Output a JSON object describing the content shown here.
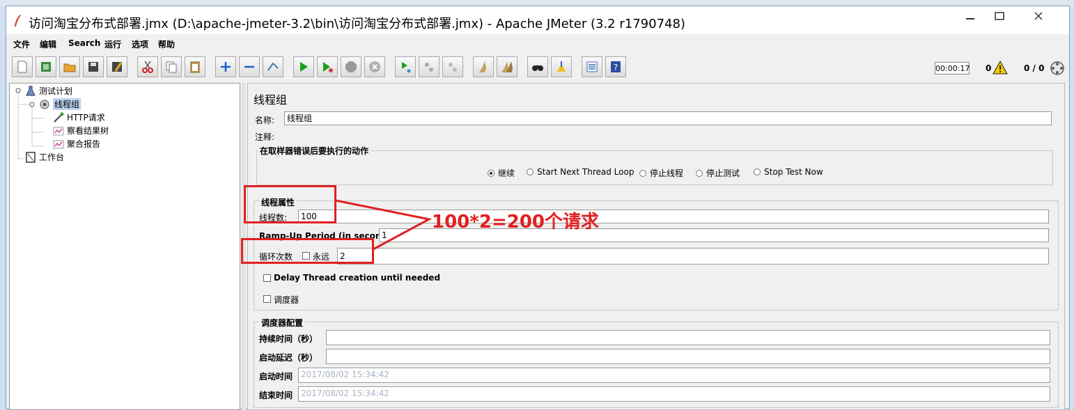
{
  "window": {
    "title": "访问淘宝分布式部署.jmx (D:\\apache-jmeter-3.2\\bin\\访问淘宝分布式部署.jmx) - Apache JMeter (3.2 r1790748)",
    "minimize_icon": "minimize-icon",
    "maximize_icon": "maximize-icon",
    "close_icon": "close-icon"
  },
  "menu": [
    "文件",
    "编辑",
    "Search",
    "运行",
    "选项",
    "帮助"
  ],
  "toolbar": {
    "icons": [
      "new-icon",
      "templates-icon",
      "open-icon",
      "save-icon",
      "save-as-icon",
      "cut-icon",
      "copy-icon",
      "paste-icon",
      "expand-icon",
      "collapse-icon",
      "toggle-icon",
      "start-icon",
      "start-no-pause-icon",
      "stop-icon",
      "shutdown-icon",
      "remote-start-icon",
      "remote-stop-icon",
      "remote-shutdown-icon",
      "clear-icon",
      "clear-all-icon",
      "search-icon",
      "reset-search-icon",
      "function-helper-icon",
      "help-icon"
    ],
    "timer": "00:00:17",
    "warning_count": "0",
    "thread_count": "0 / 0",
    "colors": {
      "start": "#1e9e1e",
      "stop": "#9a9a9a",
      "add": "#1a5fd0",
      "cut": "#d02020"
    }
  },
  "tree": {
    "items": [
      {
        "label": "测试计划",
        "icon": "test-plan-icon",
        "level": 0
      },
      {
        "label": "线程组",
        "icon": "thread-group-icon",
        "level": 1,
        "selected": true
      },
      {
        "label": "HTTP请求",
        "icon": "sampler-icon",
        "level": 2
      },
      {
        "label": "察看结果树",
        "icon": "listener-icon",
        "level": 2
      },
      {
        "label": "聚合报告",
        "icon": "listener-icon",
        "level": 2
      },
      {
        "label": "工作台",
        "icon": "workbench-icon",
        "level": 0
      }
    ]
  },
  "panel": {
    "heading": "线程组",
    "name_label": "名称:",
    "name_value": "线程组",
    "comment_label": "注释:",
    "comment_value": "",
    "on_error": {
      "title": "在取样器错误后要执行的动作",
      "options": [
        "继续",
        "Start Next Thread Loop",
        "停止线程",
        "停止测试",
        "Stop Test Now"
      ],
      "selected": "继续"
    },
    "thread_props": {
      "title": "线程属性",
      "threads_label": "线程数:",
      "threads_value": "100",
      "rampup_label": "Ramp-Up Period (in seconds):",
      "rampup_value": "1",
      "loop_label": "循环次数",
      "forever_label": "永远",
      "forever_checked": false,
      "loop_value": "2",
      "delay_label": "Delay Thread creation until needed",
      "delay_checked": false,
      "scheduler_label": "调度器",
      "scheduler_checked": false
    },
    "scheduler_config": {
      "title": "调度器配置",
      "duration_label": "持续时间（秒）",
      "duration_value": "",
      "delay_label": "启动延迟（秒）",
      "delay_value": "",
      "start_label": "启动时间",
      "start_value": "2017/08/02 15:34:42",
      "end_label": "结束时间",
      "end_value": "2017/08/02 15:34:42"
    }
  },
  "annotation": {
    "text": "100*2=200个请求",
    "color": "#e02020"
  }
}
